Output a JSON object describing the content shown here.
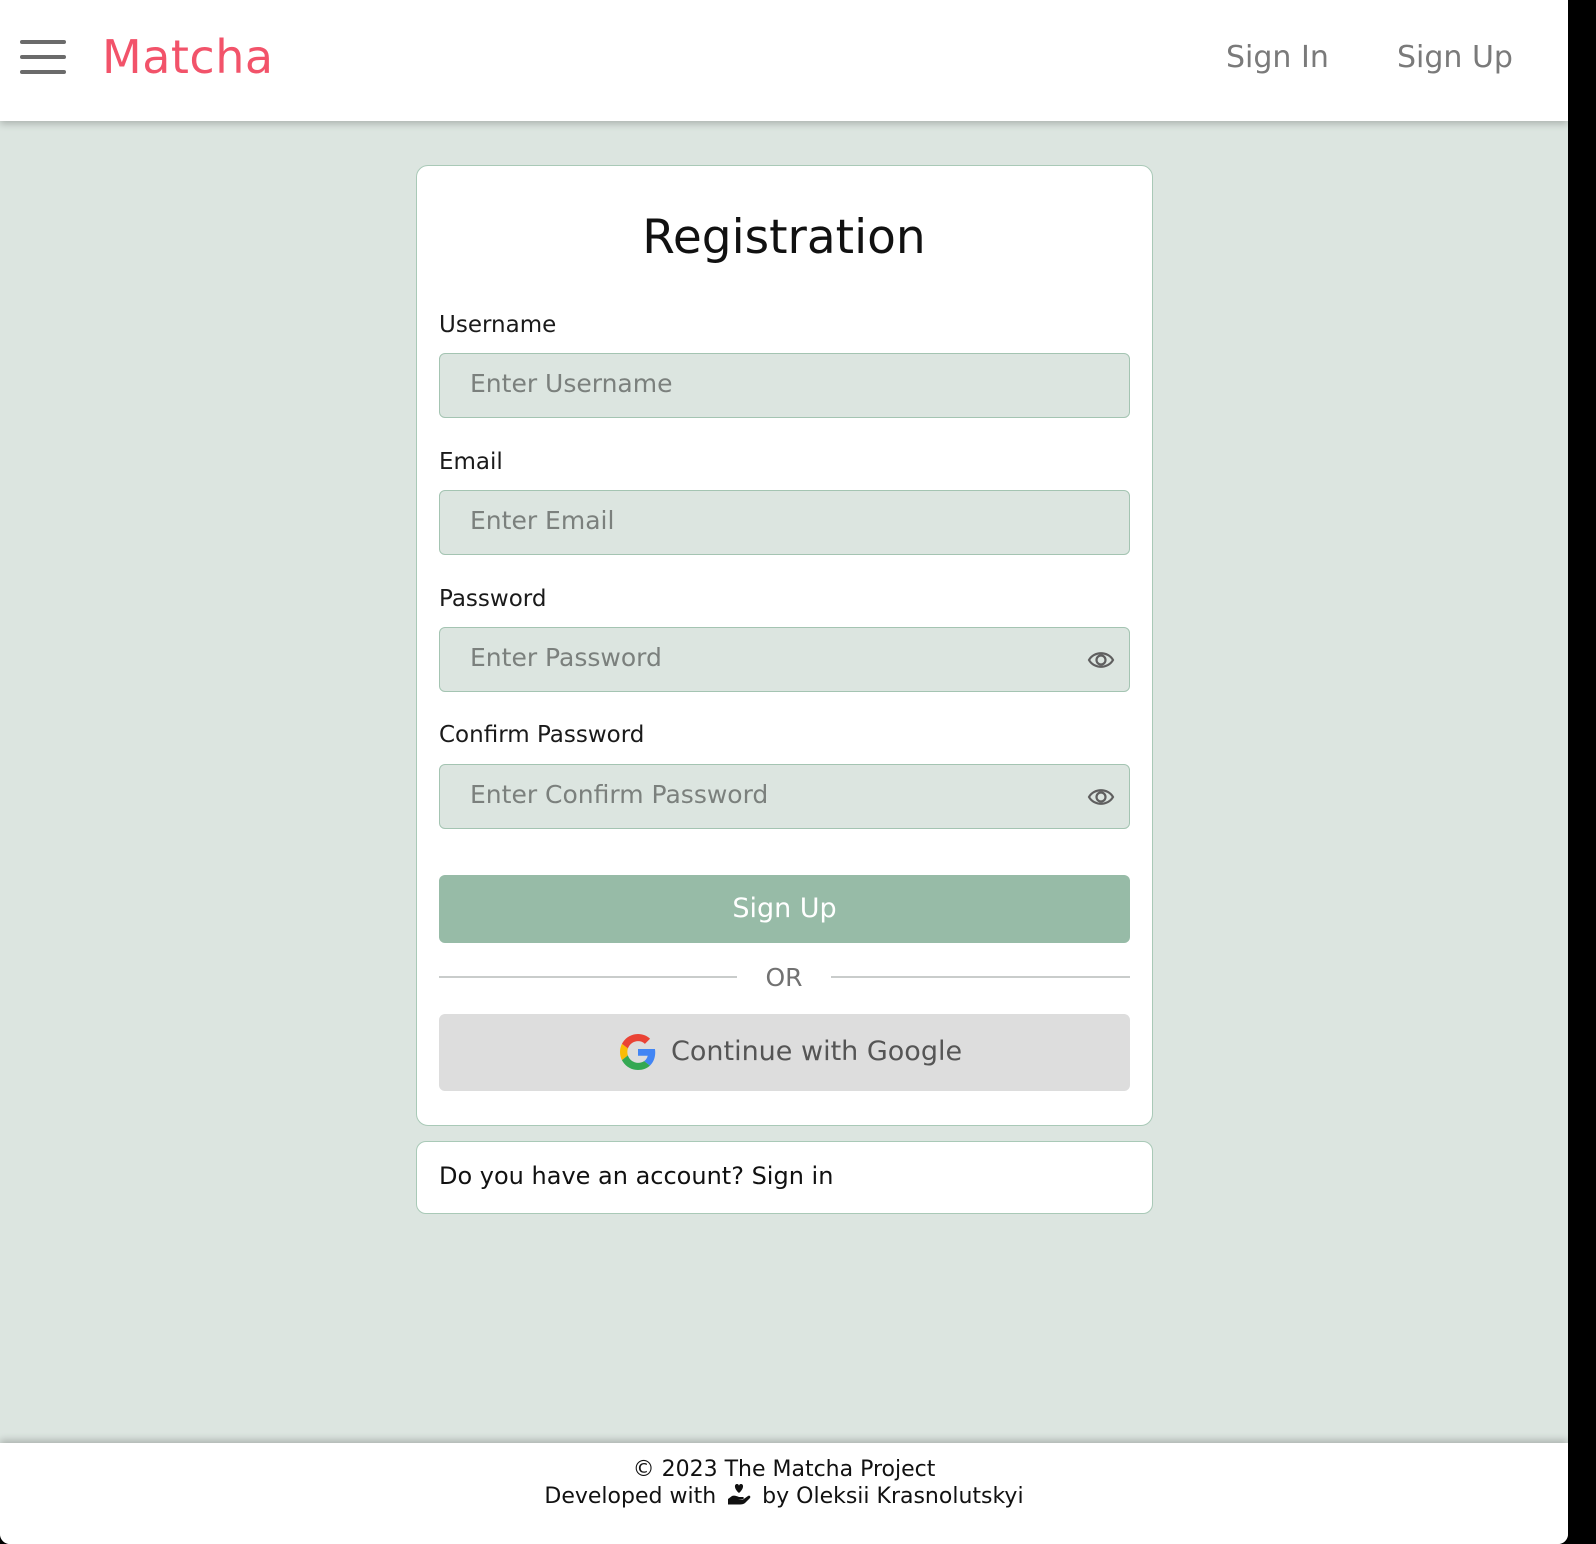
{
  "header": {
    "brand": "Matcha",
    "nav": {
      "sign_in": "Sign In",
      "sign_up": "Sign Up"
    }
  },
  "form": {
    "title": "Registration",
    "fields": [
      {
        "label": "Username",
        "placeholder": "Enter Username"
      },
      {
        "label": "Email",
        "placeholder": "Enter Email"
      },
      {
        "label": "Password",
        "placeholder": "Enter Password"
      },
      {
        "label": "Confirm Password",
        "placeholder": "Enter Confirm Password"
      }
    ],
    "submit_label": "Sign Up",
    "divider_text": "OR",
    "google_label": "Continue with Google"
  },
  "account_prompt": "Do you have an account? Sign in",
  "footer": {
    "copyright": "© 2023 The Matcha Project",
    "developed_prefix": "Developed with",
    "developed_suffix": "by Oleksii Krasnolutskyi"
  },
  "icons": {
    "menu": "hamburger-menu-icon",
    "password_toggle": "eye-icon",
    "google": "google-icon",
    "footer": "heart-hand-icon"
  },
  "colors": {
    "brand": "#f2536a",
    "background": "#dce5e0",
    "primary_button": "#97bba7",
    "google_button": "#dddddd"
  }
}
